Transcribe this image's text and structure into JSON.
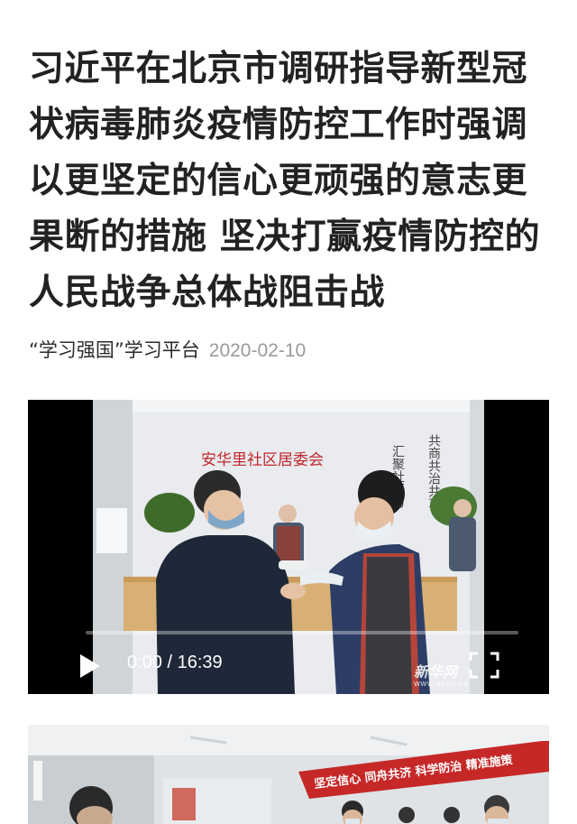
{
  "article": {
    "title": "习近平在北京市调研指导新型冠状病毒肺炎疫情防控工作时强调以更坚定的信心更顽强的意志更果断的措施 坚决打赢疫情防控的人民战争总体战阻击战",
    "source": "“学习强国”学习平台",
    "date": "2020-02-10"
  },
  "video": {
    "current_time": "0:00",
    "separator": "/",
    "duration": "16:39",
    "progress": 0,
    "scene_sign": "安华里社区居委会",
    "scene_couplet_right": "共商共治共享",
    "scene_couplet_left": "汇聚社区力",
    "watermark": "新华网",
    "watermark_url": "WWW.NEWS.CN",
    "icons": {
      "play": "play-icon",
      "fullscreen": "fullscreen-icon"
    }
  },
  "photo": {
    "banner_text": "坚定信心  同舟共济  科学防治  精准施策"
  }
}
